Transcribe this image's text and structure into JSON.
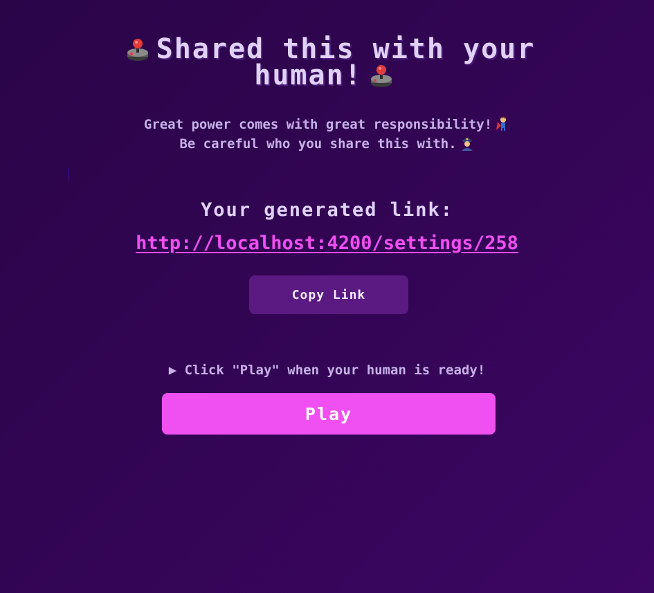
{
  "header": {
    "title_line1": "Shared this with your",
    "title_line2": "human!",
    "title_icon": "joystick-icon"
  },
  "subtitle": {
    "line1": "Great power comes with great responsibility!",
    "line1_icon": "superhero-icon",
    "line2": "Be careful who you share this with.",
    "line2_icon": "police-officer-icon"
  },
  "link_section": {
    "label": "Your generated link:",
    "url": "http://localhost:4200/settings/258",
    "copy_label": "Copy Link"
  },
  "play_section": {
    "hint": "▶ Click \"Play\" when your human is ready!",
    "play_label": "Play"
  },
  "colors": {
    "background_start": "#2a0548",
    "background_end": "#3c0663",
    "accent_pink": "#f04ff1",
    "copy_button": "#5a1a82",
    "text_light": "#e0d2f7"
  }
}
